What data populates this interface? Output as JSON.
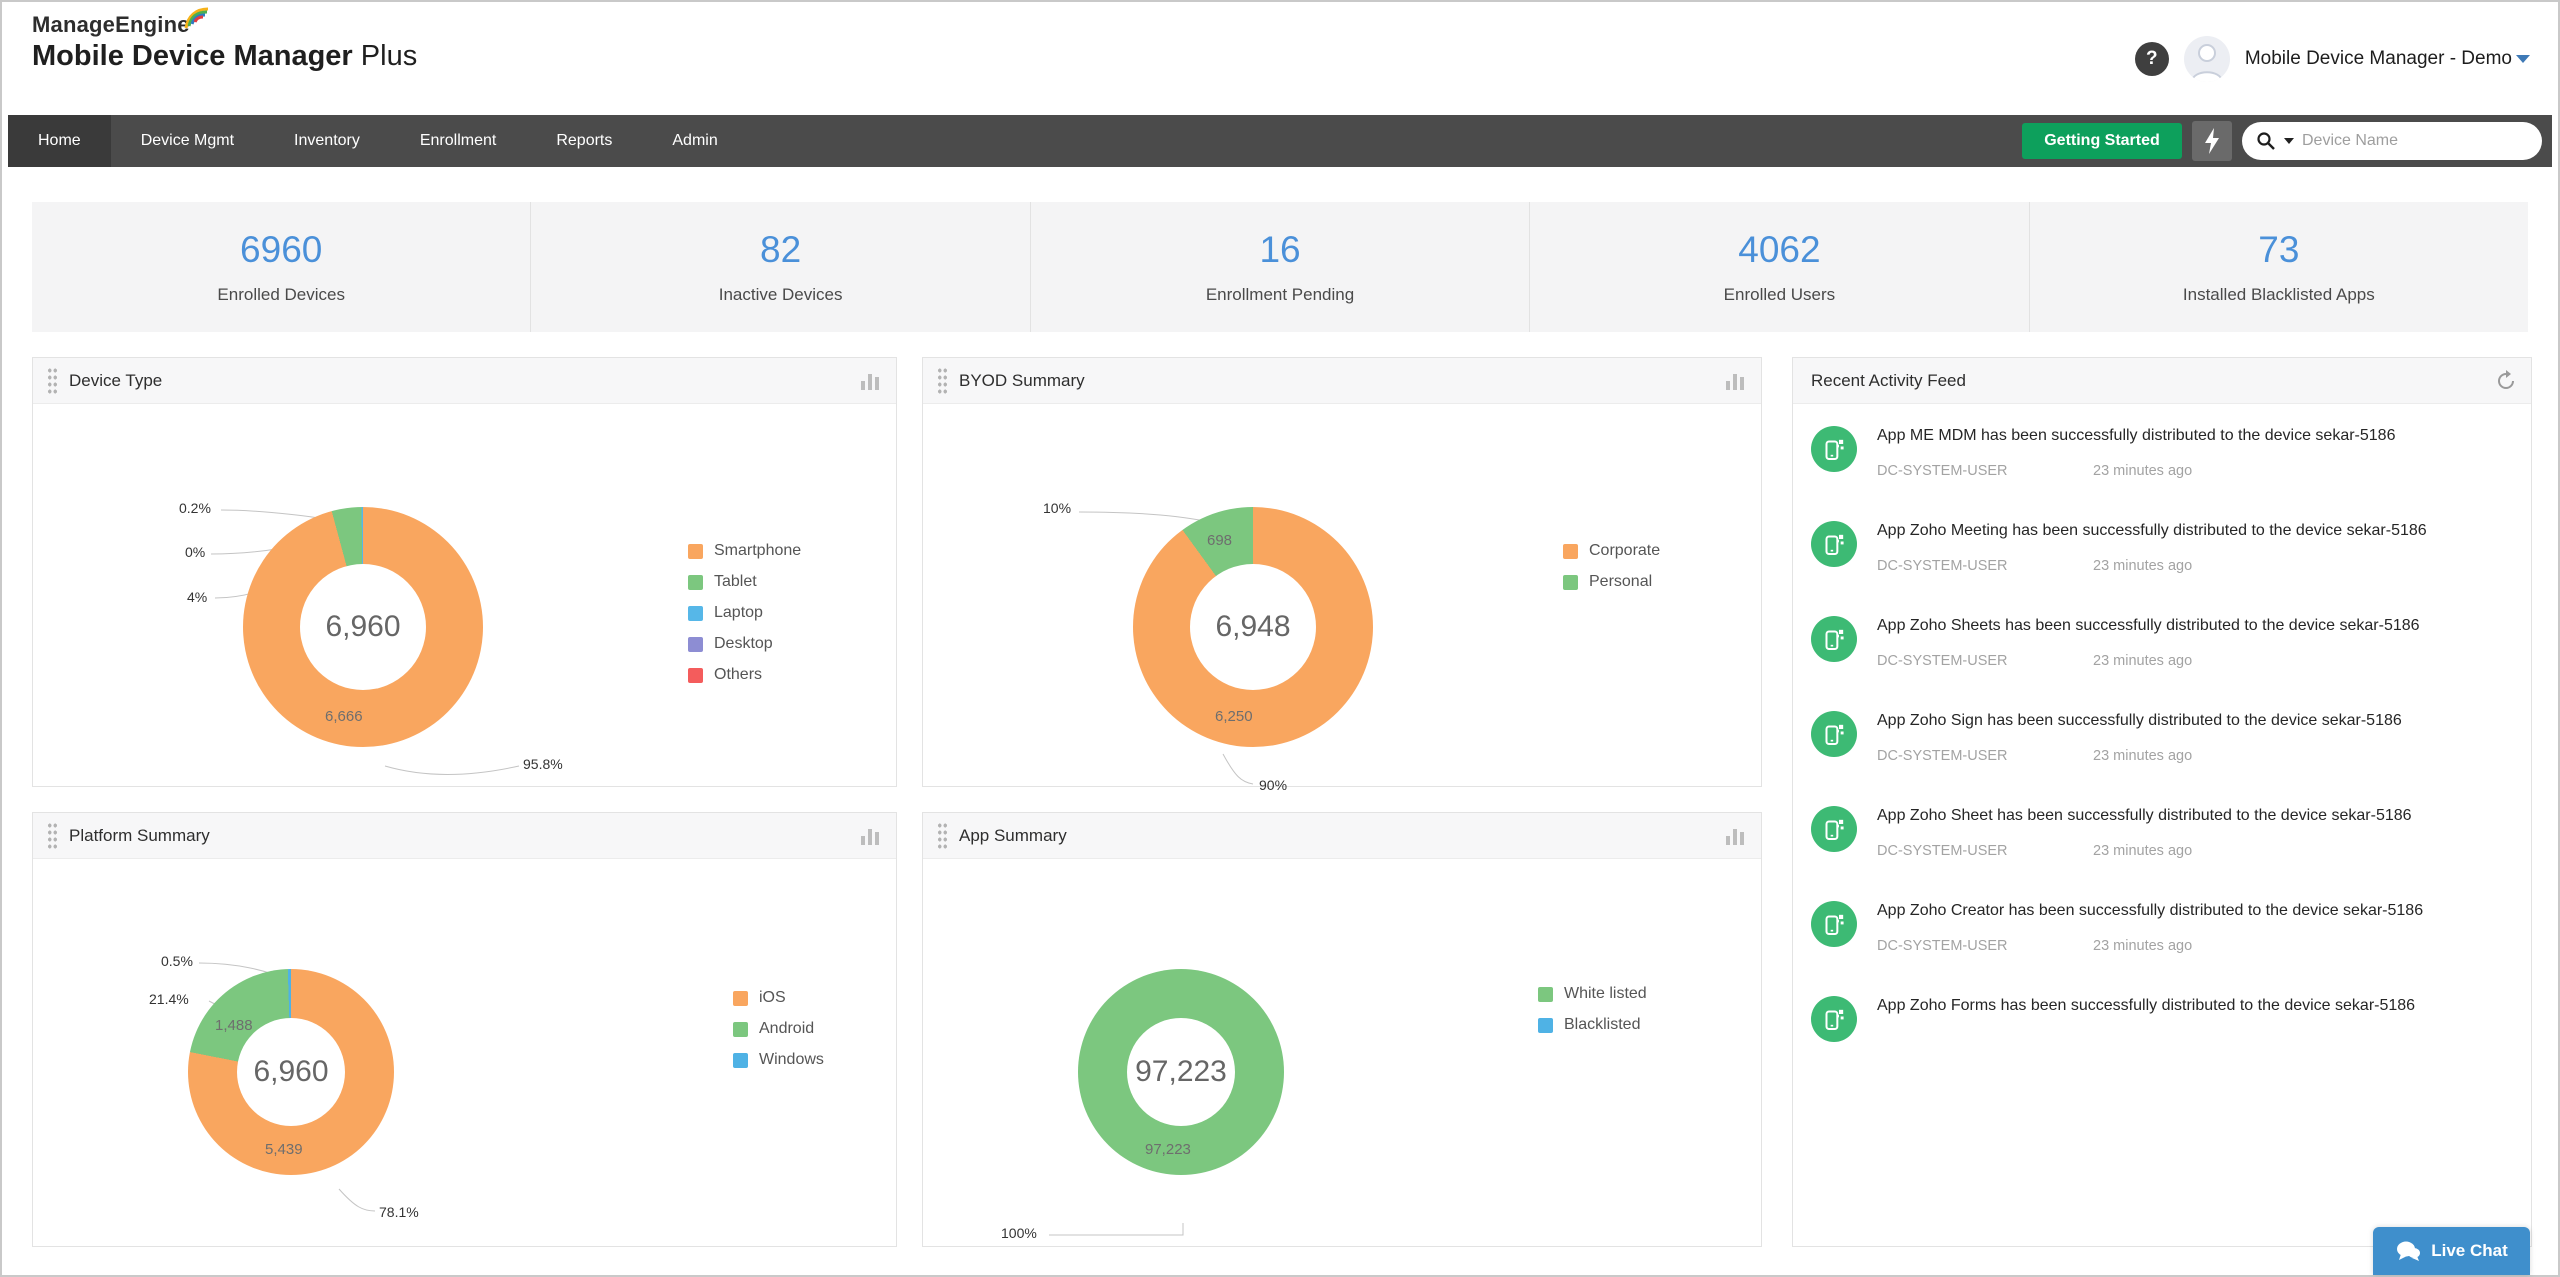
{
  "header": {
    "brand_top": "ManageEngine",
    "brand_main": "Mobile Device Manager",
    "brand_suffix": "Plus",
    "account_name": "Mobile Device Manager - Demo"
  },
  "nav": {
    "items": [
      "Home",
      "Device Mgmt",
      "Inventory",
      "Enrollment",
      "Reports",
      "Admin"
    ],
    "getting_started": "Getting Started",
    "search_placeholder": "Device Name"
  },
  "stats": [
    {
      "value": "6960",
      "label": "Enrolled Devices"
    },
    {
      "value": "82",
      "label": "Inactive Devices"
    },
    {
      "value": "16",
      "label": "Enrollment Pending"
    },
    {
      "value": "4062",
      "label": "Enrolled Users"
    },
    {
      "value": "73",
      "label": "Installed Blacklisted Apps"
    }
  ],
  "chart_data": [
    {
      "id": "device-type",
      "type": "pie",
      "title": "Device Type",
      "center": "6,960",
      "legend_position": "right",
      "slices": [
        {
          "name": "Smartphone",
          "color": "#F9A65F",
          "pct": 95.8,
          "pct_label": "95.8%",
          "value_label": "6,666"
        },
        {
          "name": "Tablet",
          "color": "#7CC77F",
          "pct": 4,
          "pct_label": "4%"
        },
        {
          "name": "Laptop",
          "color": "#56B7E8",
          "pct": 0.2,
          "pct_label": "0.2%"
        },
        {
          "name": "Desktop",
          "color": "#8D8DD3",
          "pct": 0,
          "pct_label": "0%"
        },
        {
          "name": "Others",
          "color": "#F45C5C",
          "pct": 0
        }
      ]
    },
    {
      "id": "byod-summary",
      "type": "pie",
      "title": "BYOD Summary",
      "center": "6,948",
      "legend_position": "right",
      "slices": [
        {
          "name": "Corporate",
          "color": "#F9A65F",
          "pct": 90,
          "pct_label": "90%",
          "value_label": "6,250"
        },
        {
          "name": "Personal",
          "color": "#7CC77F",
          "pct": 10,
          "pct_label": "10%",
          "value_label": "698"
        }
      ]
    },
    {
      "id": "platform-summary",
      "type": "pie",
      "title": "Platform Summary",
      "center": "6,960",
      "legend_position": "right",
      "slices": [
        {
          "name": "iOS",
          "color": "#F9A65F",
          "pct": 78.1,
          "pct_label": "78.1%",
          "value_label": "5,439"
        },
        {
          "name": "Android",
          "color": "#7CC77F",
          "pct": 21.4,
          "pct_label": "21.4%",
          "value_label": "1,488"
        },
        {
          "name": "Windows",
          "color": "#4FB2E5",
          "pct": 0.5,
          "pct_label": "0.5%"
        }
      ]
    },
    {
      "id": "app-summary",
      "type": "pie",
      "title": "App Summary",
      "center": "97,223",
      "legend_position": "right",
      "slices": [
        {
          "name": "White listed",
          "color": "#7CC77F",
          "pct": 100,
          "pct_label": "100%",
          "value_label": "97,223"
        },
        {
          "name": "Blacklisted",
          "color": "#4FB2E5",
          "pct": 0
        }
      ]
    }
  ],
  "activity": {
    "title": "Recent Activity Feed",
    "items": [
      {
        "title": "App ME MDM has been successfully distributed to the device sekar-5186",
        "user": "DC-SYSTEM-USER",
        "time": "23 minutes ago"
      },
      {
        "title": "App Zoho Meeting has been successfully distributed to the device sekar-5186",
        "user": "DC-SYSTEM-USER",
        "time": "23 minutes ago"
      },
      {
        "title": "App Zoho Sheets has been successfully distributed to the device sekar-5186",
        "user": "DC-SYSTEM-USER",
        "time": "23 minutes ago"
      },
      {
        "title": "App Zoho Sign has been successfully distributed to the device sekar-5186",
        "user": "DC-SYSTEM-USER",
        "time": "23 minutes ago"
      },
      {
        "title": "App Zoho Sheet has been successfully distributed to the device sekar-5186",
        "user": "DC-SYSTEM-USER",
        "time": "23 minutes ago"
      },
      {
        "title": "App Zoho Creator has been successfully distributed to the device sekar-5186",
        "user": "DC-SYSTEM-USER",
        "time": "23 minutes ago"
      },
      {
        "title": "App Zoho Forms has been successfully distributed to the device sekar-5186",
        "user": "",
        "time": ""
      }
    ]
  },
  "live_chat_label": "Live Chat",
  "colors": {
    "accent_blue": "#4A90D9",
    "nav_bg": "#4B4B4B",
    "green_button": "#0DA05C",
    "live_chat_blue": "#3F8FCC",
    "feed_icon_green": "#3DBA74"
  }
}
